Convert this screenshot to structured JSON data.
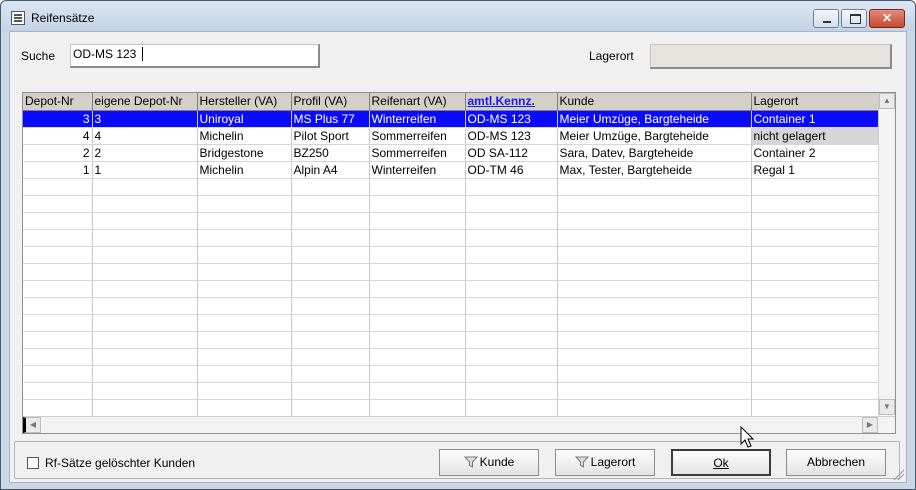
{
  "window": {
    "title": "Reifensätze"
  },
  "search": {
    "label": "Suche",
    "value": "OD-MS 123"
  },
  "lagerort": {
    "label": "Lagerort",
    "value": ""
  },
  "grid": {
    "columns": [
      "Depot-Nr",
      "eigene Depot-Nr",
      "Hersteller (VA)",
      "Profil (VA)",
      "Reifenart (VA)",
      "amtl.Kennz.",
      "Kunde",
      "Lagerort"
    ],
    "sorted_column": "amtl.Kennz.",
    "rows": [
      {
        "depot_nr": "3",
        "eigene_depot_nr": "3",
        "hersteller": "Uniroyal",
        "profil": "MS Plus 77",
        "reifenart": "Winterreifen",
        "kennz": "OD-MS 123",
        "kunde": "Meier Umzüge, Bargteheide",
        "lagerort": "Container 1",
        "selected": true
      },
      {
        "depot_nr": "4",
        "eigene_depot_nr": "4",
        "hersteller": "Michelin",
        "profil": "Pilot Sport",
        "reifenart": "Sommerreifen",
        "kennz": "OD-MS 123",
        "kunde": "Meier Umzüge, Bargteheide",
        "lagerort": "nicht gelagert",
        "selected": false
      },
      {
        "depot_nr": "2",
        "eigene_depot_nr": "2",
        "hersteller": "Bridgestone",
        "profil": "BZ250",
        "reifenart": "Sommerreifen",
        "kennz": "OD SA-112",
        "kunde": "Sara, Datev, Bargteheide",
        "lagerort": "Container 2",
        "selected": false
      },
      {
        "depot_nr": "1",
        "eigene_depot_nr": "1",
        "hersteller": "Michelin",
        "profil": "Alpin A4",
        "reifenart": "Winterreifen",
        "kennz": "OD-TM 46",
        "kunde": "Max, Tester, Bargteheide",
        "lagerort": "Regal 1",
        "selected": false
      }
    ]
  },
  "checkbox": {
    "label": "Rf-Sätze gelöschter Kunden",
    "checked": false
  },
  "buttons": {
    "kunde": "Kunde",
    "lagerort": "Lagerort",
    "ok": "Ok",
    "abbrechen": "Abbrechen"
  },
  "colors": {
    "selection": "#0a0aff",
    "sorted_header": "#1a1af0",
    "dialog_bg": "#f0f0f0"
  },
  "icons": {
    "filter": "funnel-icon"
  }
}
